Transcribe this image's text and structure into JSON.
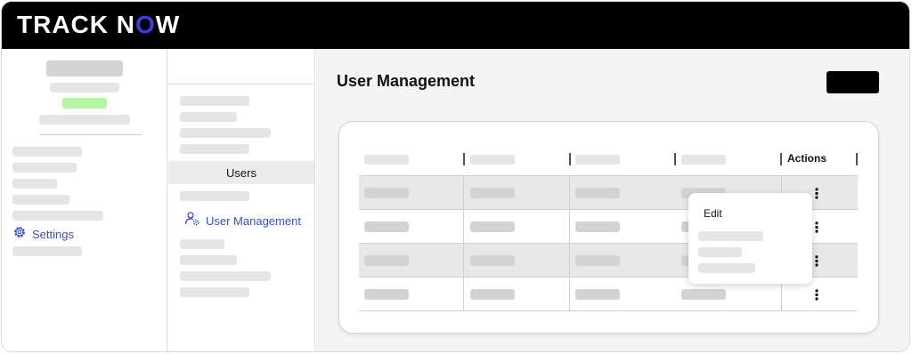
{
  "header": {
    "logo_main": "TRACK N",
    "logo_accent": "O",
    "logo_tail": "W"
  },
  "sidebar": {
    "settings_label": "Settings",
    "settings_icon": "gear-icon"
  },
  "subnav": {
    "users_label": "Users",
    "user_management_label": "User Management",
    "user_management_icon": "user-gear-icon"
  },
  "main": {
    "title": "User Management",
    "table": {
      "actions_header": "Actions",
      "kebab_glyph": "⋮"
    },
    "row_menu": {
      "edit_label": "Edit"
    }
  },
  "colors": {
    "accent": "#3c4fbf",
    "logo_accent": "#3b3fd8",
    "status_green": "#b6f5a3",
    "topbar": "#000000"
  }
}
